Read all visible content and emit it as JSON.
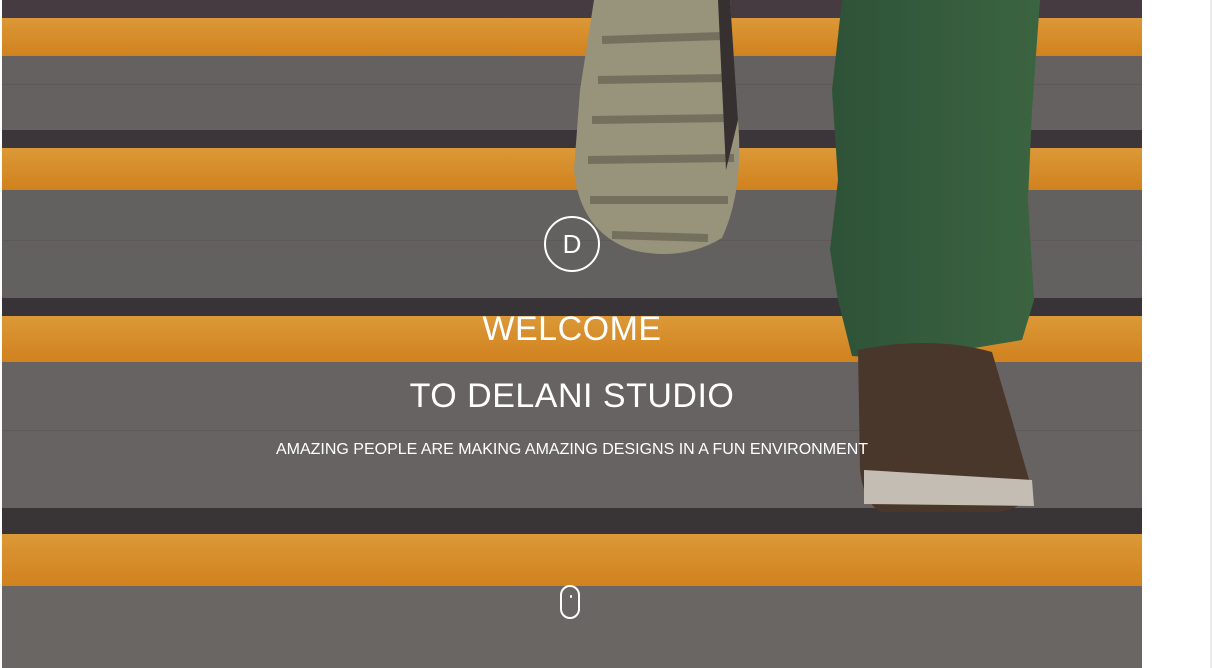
{
  "hero": {
    "logo_letter": "D",
    "welcome": "WELCOME",
    "studio": "TO DELANI STUDIO",
    "tagline": "AMAZING PEOPLE ARE MAKING AMAZING DESIGNS IN A FUN ENVIRONMENT",
    "background_image": "stairs-walking-photo",
    "scroll_icon": "mouse-scroll-icon"
  },
  "colors": {
    "stair_orange": "#f3a12a",
    "concrete": "#6b6866",
    "text": "#ffffff"
  }
}
